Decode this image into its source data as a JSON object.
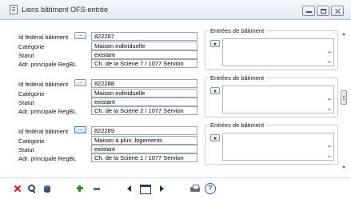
{
  "window": {
    "title": "Liens bâtiment OFS-entrée"
  },
  "labels": {
    "federal_id": "Id fédéral bâtiment",
    "category": "Catégorie",
    "status": "Statut",
    "address": "Adr. principale RegBL",
    "entries_group": "Entrées de bâtiment"
  },
  "records": [
    {
      "federal_id": "822287",
      "category": "Maison individuelle",
      "status": "existant",
      "address": "Ch. de la Scierie 7 / 1077 Servion",
      "lookup_button": "...",
      "active": false
    },
    {
      "federal_id": "822288",
      "category": "Maison individuelle",
      "status": "existant",
      "address": "Ch. de la Scierie 2 / 1077 Servion",
      "lookup_button": "...",
      "active": false
    },
    {
      "federal_id": "822289",
      "category": "Maison à plus. logements",
      "status": "existant",
      "address": "Ch. de la Scierie 1 / 1077 Servion",
      "lookup_button": "...",
      "active": true
    }
  ],
  "toolbar": {
    "icons": [
      "delete-icon",
      "search-icon",
      "database-icon",
      "add-icon",
      "remove-icon",
      "previous-icon",
      "table-icon",
      "next-icon",
      "print-icon",
      "help-icon"
    ]
  }
}
